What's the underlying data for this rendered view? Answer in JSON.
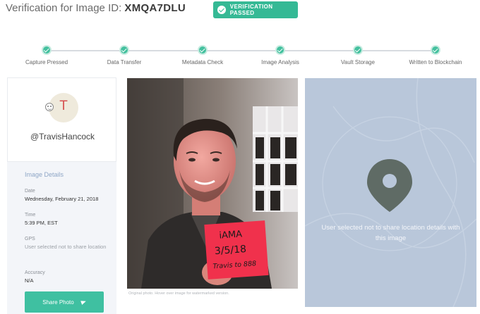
{
  "header": {
    "title_prefix": "Verification for Image ID:",
    "image_id": "XMQA7DLU",
    "status_badge": "VERIFICATION PASSED"
  },
  "steps": [
    {
      "label": "Capture Pressed",
      "status": "complete"
    },
    {
      "label": "Data Transfer",
      "status": "complete"
    },
    {
      "label": "Metadata Check",
      "status": "complete"
    },
    {
      "label": "Image Analysis",
      "status": "complete"
    },
    {
      "label": "Vault Storage",
      "status": "complete"
    },
    {
      "label": "Written to Blockchain",
      "status": "complete"
    }
  ],
  "profile": {
    "avatar_letter": "T",
    "username": "@TravisHancock"
  },
  "details": {
    "title": "Image Details",
    "date_label": "Date",
    "date_value": "Wednesday, February 21, 2018",
    "time_label": "Time",
    "time_value": "5:39 PM, EST",
    "gps_label": "GPS",
    "gps_value": "User selected not to share location",
    "accuracy_label": "Accuracy",
    "accuracy_value": "N/A"
  },
  "share_button": {
    "label": "Share Photo"
  },
  "photo": {
    "sign_lines": [
      "iAMA",
      "3/5/18",
      "Travis to 888"
    ],
    "caption": "Original photo. Hover over image for watermarked version."
  },
  "map": {
    "message": "User selected not to share location details with this image"
  },
  "colors": {
    "accent": "#35b995",
    "map_bg": "#b9c7da",
    "pin": "#5f6b65",
    "sign": "#f0314c"
  }
}
